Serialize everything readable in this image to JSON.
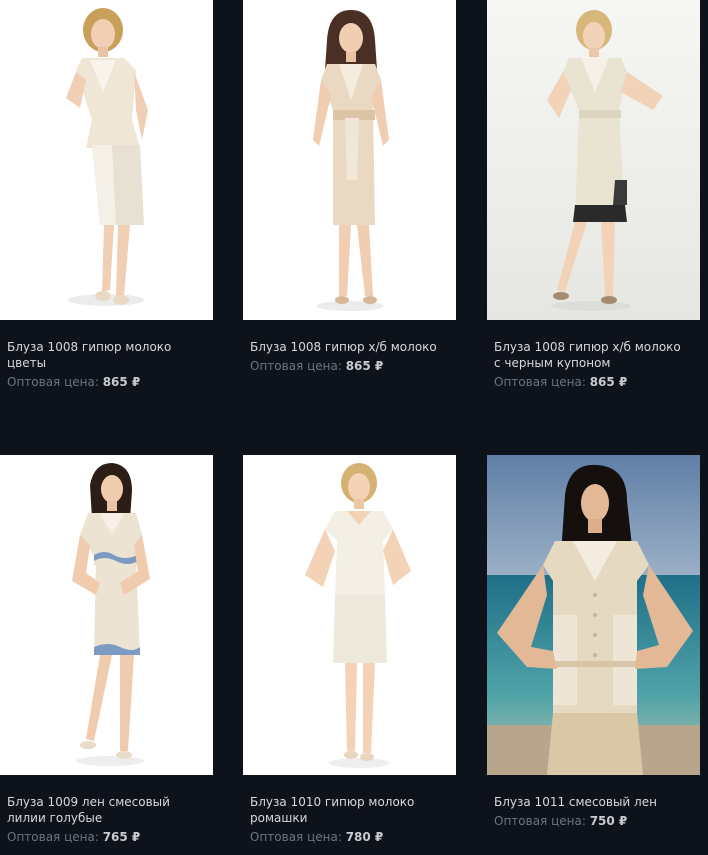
{
  "products": [
    {
      "title": "Блуза 1008 гипюр молоко цветы",
      "price_label": "Оптовая цена:",
      "price": "865 ₽",
      "image": "model-cream-suit"
    },
    {
      "title": "Блуза 1008 гипюр х/б молоко",
      "price_label": "Оптовая цена:",
      "price": "865 ₽",
      "image": "model-beige-dress-belt"
    },
    {
      "title": "Блуза 1008 гипюр х/б молоко с черным купоном",
      "price_label": "Оптовая цена:",
      "price": "865 ₽",
      "image": "model-dress-black-hem"
    },
    {
      "title": "Блуза 1009 лен смесовый лилии голубые",
      "price_label": "Оптовая цена:",
      "price": "765 ₽",
      "image": "model-linen-blue-lilies"
    },
    {
      "title": "Блуза 1010 гипюр молоко ромашки",
      "price_label": "Оптовая цена:",
      "price": "780 ₽",
      "image": "model-lace-blouse"
    },
    {
      "title": "Блуза 1011 смесовый лен",
      "price_label": "Оптовая цена:",
      "price": "750 ₽",
      "image": "model-beach-linen"
    }
  ],
  "colors": {
    "background": "#0e121b",
    "title_text": "#d6d9df",
    "price_label": "#6d7380",
    "price_value": "#c7cbd2"
  }
}
